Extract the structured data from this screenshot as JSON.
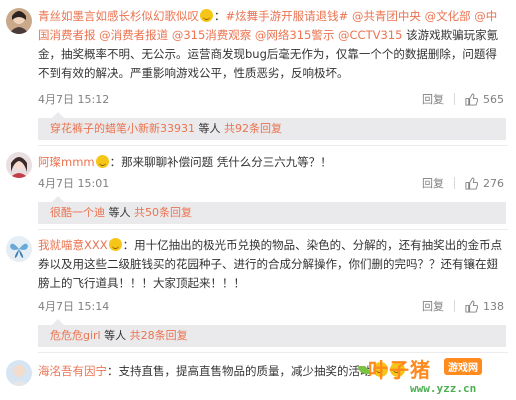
{
  "comments": [
    {
      "username": "青丝如墨言如感长杉似幻歌似叹",
      "mention1": "#炫舞手游开服请退钱#",
      "mention2": "@共青团中央",
      "mention3": "@文化部",
      "mention4": "@中国消费者报",
      "mention5": "@消费者报道",
      "mention6": "@315消费观察",
      "mention7": "@网络315警示",
      "mention8": "@CCTV315",
      "body_part1": "该游戏欺骗玩家氪金，抽奖概率不明、无公示。运营商发现bug后毫无作为，仅靠一个个的数据删除，问题得不到有效的解决。严重影响游戏公平，性质恶劣，反响极坏。",
      "date": "4月7日 15:12",
      "reply_label": "回复",
      "likes": "565",
      "sub_user": "穿花裤子的蜡笔小新新33931",
      "sub_text": "等人",
      "sub_count": "共92条回复"
    },
    {
      "username": "阿璨mmm",
      "body": "：那来聊聊补偿问题 凭什么分三六九等？！",
      "date": "4月7日 15:01",
      "reply_label": "回复",
      "likes": "276",
      "sub_user": "很酷一个迪",
      "sub_text": "等人",
      "sub_count": "共50条回复"
    },
    {
      "username": "我就喵意XXX",
      "body": "：用十亿抽出的极光币兑换的物品、染色的、分解的，还有抽奖出的金币点券以及用这些二级脏钱买的花园种子、进行的合成分解操作，你们删的完吗？？还有镶在翅膀上的飞行道具！！！大家顶起来！！！",
      "date": "4月7日 15:14",
      "reply_label": "回复",
      "likes": "138",
      "sub_user": "危危危girl",
      "sub_text": "等人",
      "sub_count": "共28条回复"
    },
    {
      "username": "海洺吾有因宁",
      "body": "：支持直售，提高直售物品的质量，减少抽奖的活动"
    }
  ],
  "watermark": {
    "main": "叶子猪",
    "tag": "游戏网",
    "url": "www.yzz.cn"
  },
  "colors": {
    "accent": "#eb7350",
    "subbox": "#eaeaec",
    "meta": "#808080"
  }
}
